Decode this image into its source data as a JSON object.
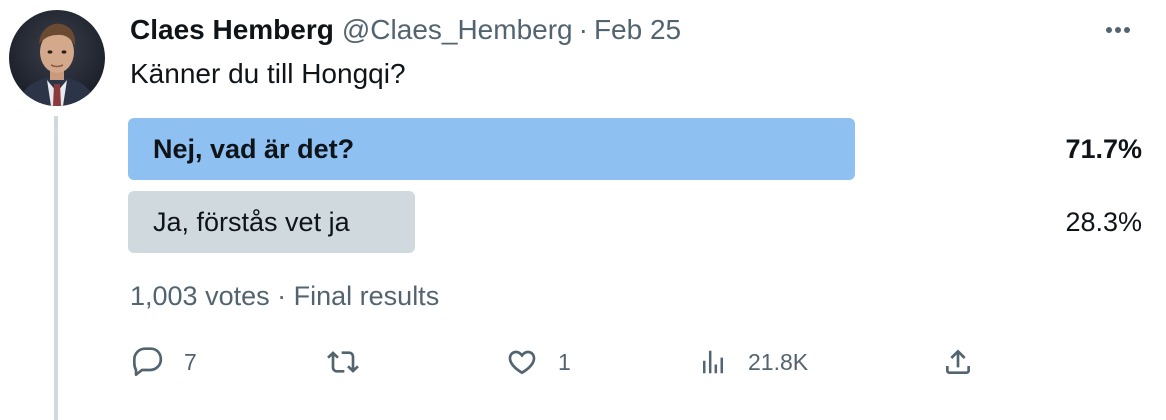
{
  "tweet": {
    "author_name": "Claes Hemberg",
    "handle": "@Claes_Hemberg",
    "separator": "·",
    "date": "Feb 25",
    "text": "Känner du till Hongqi?"
  },
  "poll": {
    "options": [
      {
        "label": "Nej, vad är det?",
        "percent": "71.7%",
        "share": 0.717,
        "winner": true
      },
      {
        "label": "Ja, förstås vet ja",
        "percent": "28.3%",
        "share": 0.283,
        "winner": false
      }
    ],
    "votes": "1,003 votes",
    "separator": "·",
    "status": "Final results"
  },
  "actions": {
    "reply_count": "7",
    "like_count": "1",
    "views_count": "21.8K"
  },
  "icons": {
    "more": "more-horizontal-icon",
    "reply": "reply-icon",
    "retweet": "retweet-icon",
    "like": "heart-icon",
    "views": "views-icon",
    "share": "share-icon"
  },
  "colors": {
    "winner_bar": "#8ec0f2",
    "other_bar": "#cfd9de",
    "secondary_text": "#536471",
    "primary_text": "#0f1419",
    "thread_line": "#cfd9de"
  }
}
